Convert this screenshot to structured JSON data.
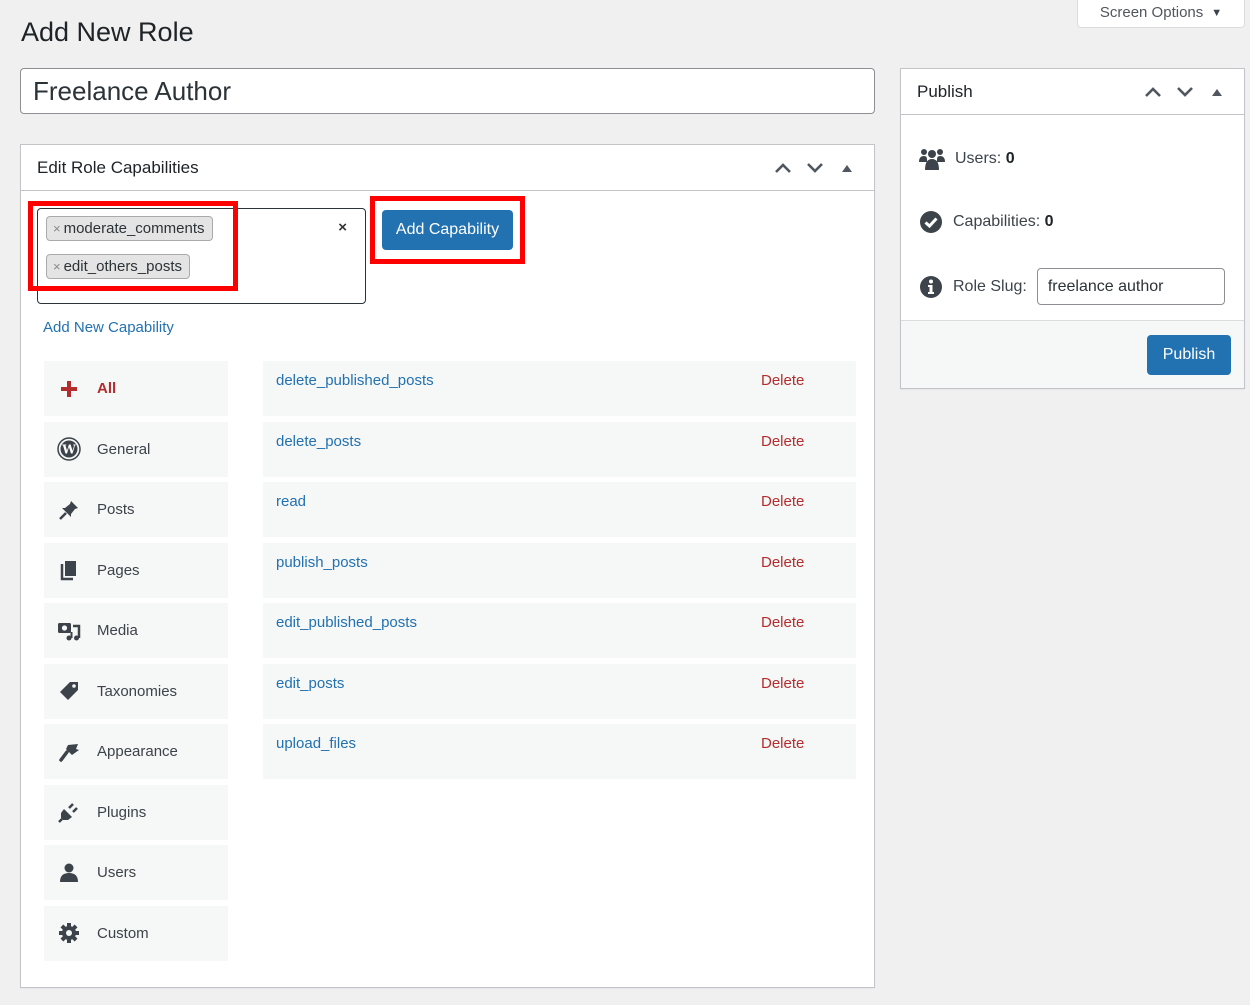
{
  "screen_options": {
    "label": "Screen Options",
    "caret": "▼"
  },
  "page_title": "Add New Role",
  "role_name": {
    "value": "Freelance Author"
  },
  "capabilities_box": {
    "title": "Edit Role Capabilities",
    "selected_tags": [
      {
        "label": "moderate_comments",
        "remove": "×"
      },
      {
        "label": "edit_others_posts",
        "remove": "×"
      }
    ],
    "clear_all": "×",
    "add_button": "Add Capability",
    "add_new_link": "Add New Capability",
    "categories": [
      {
        "label": "All",
        "icon": "plus-icon",
        "active": true
      },
      {
        "label": "General",
        "icon": "wordpress-icon"
      },
      {
        "label": "Posts",
        "icon": "pushpin-icon"
      },
      {
        "label": "Pages",
        "icon": "pages-icon"
      },
      {
        "label": "Media",
        "icon": "media-icon"
      },
      {
        "label": "Taxonomies",
        "icon": "tag-icon"
      },
      {
        "label": "Appearance",
        "icon": "paintbrush-icon"
      },
      {
        "label": "Plugins",
        "icon": "plug-icon"
      },
      {
        "label": "Users",
        "icon": "user-icon"
      },
      {
        "label": "Custom",
        "icon": "gear-icon"
      }
    ],
    "capabilities": [
      {
        "name": "delete_published_posts",
        "action": "Delete"
      },
      {
        "name": "delete_posts",
        "action": "Delete"
      },
      {
        "name": "read",
        "action": "Delete"
      },
      {
        "name": "publish_posts",
        "action": "Delete"
      },
      {
        "name": "edit_published_posts",
        "action": "Delete"
      },
      {
        "name": "edit_posts",
        "action": "Delete"
      },
      {
        "name": "upload_files",
        "action": "Delete"
      }
    ]
  },
  "publish_box": {
    "title": "Publish",
    "users_label": "Users:",
    "users_count": "0",
    "capabilities_label": "Capabilities:",
    "capabilities_count": "0",
    "slug_label": "Role Slug:",
    "slug_value": "freelance author",
    "publish_button": "Publish"
  },
  "colors": {
    "primary": "#2271b1",
    "danger": "#b32d2e",
    "highlight": "#ff0000",
    "background": "#f0f0f1"
  }
}
